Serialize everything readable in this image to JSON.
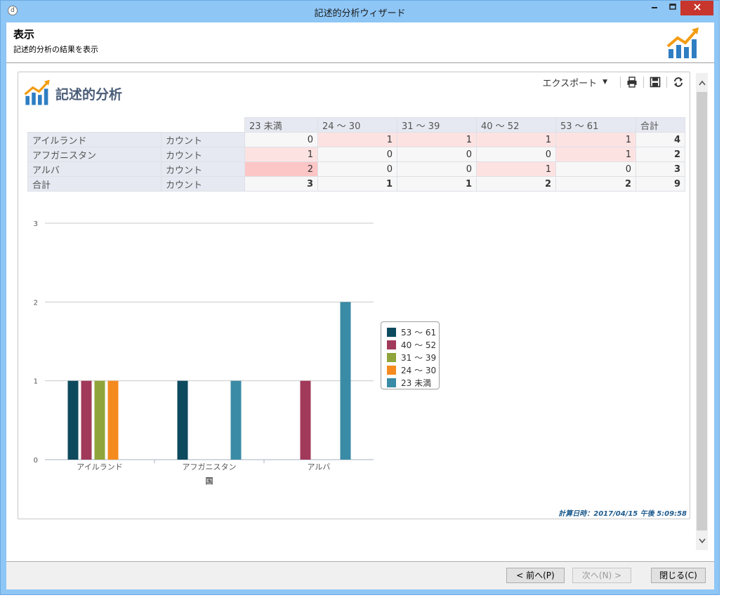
{
  "window": {
    "title": "記述的分析ウィザード",
    "app_icon": "d"
  },
  "header": {
    "title": "表示",
    "subtitle": "記述的分析の結果を表示"
  },
  "panel": {
    "title": "記述的分析",
    "toolbar": {
      "export_label": "エクスポート",
      "icons": [
        "print-icon",
        "save-icon",
        "refresh-icon"
      ]
    }
  },
  "table": {
    "columns": [
      "23 未満",
      "24 ～ 30",
      "31 ～ 39",
      "40 ～ 52",
      "53 ～ 61",
      "合計"
    ],
    "rows": [
      {
        "country": "アイルランド",
        "measure": "カウント",
        "values": [
          "0",
          "1",
          "1",
          "1",
          "1"
        ],
        "total": "4"
      },
      {
        "country": "アフガニスタン",
        "measure": "カウント",
        "values": [
          "1",
          "0",
          "0",
          "0",
          "1"
        ],
        "total": "2"
      },
      {
        "country": "アルバ",
        "measure": "カウント",
        "values": [
          "2",
          "0",
          "0",
          "1",
          "0"
        ],
        "total": "3"
      }
    ],
    "total_row": {
      "country": "合計",
      "measure": "カウント",
      "values": [
        "3",
        "1",
        "1",
        "2",
        "2"
      ],
      "total": "9"
    }
  },
  "chart_data": {
    "type": "bar",
    "categories": [
      "アイルランド",
      "アフガニスタン",
      "アルバ"
    ],
    "xlabel": "国",
    "ylabel": "",
    "ylim": [
      0,
      3
    ],
    "yticks": [
      "0",
      "1",
      "2",
      "3"
    ],
    "grid": true,
    "legend": "right",
    "series": [
      {
        "name": "53 ～ 61",
        "color": "#0e4a5e",
        "values": [
          1,
          1,
          0
        ]
      },
      {
        "name": "40 ～ 52",
        "color": "#a1395a",
        "values": [
          1,
          0,
          1
        ]
      },
      {
        "name": "31 ～ 39",
        "color": "#8fa43a",
        "values": [
          1,
          0,
          0
        ]
      },
      {
        "name": "24 ～ 30",
        "color": "#f58a1f",
        "values": [
          1,
          0,
          0
        ]
      },
      {
        "name": "23 未満",
        "color": "#3a8ba5",
        "values": [
          0,
          1,
          2
        ]
      }
    ]
  },
  "calc_time": "計算日時：2017/04/15 午後 5:09:58",
  "buttons": {
    "prev": "< 前へ(P)",
    "next": "次へ(N) >",
    "close": "閉じる(C)"
  }
}
